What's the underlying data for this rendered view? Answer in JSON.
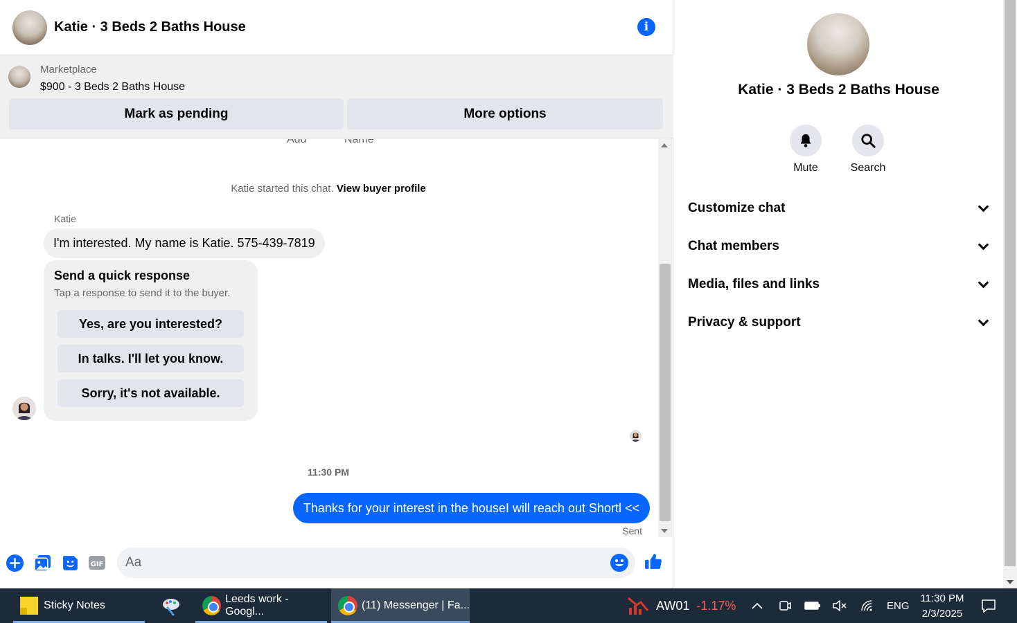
{
  "header": {
    "title": "Katie · 3 Beds 2 Baths House"
  },
  "listing": {
    "source": "Marketplace",
    "title": "$900 - 3 Beds 2 Baths House",
    "pending_label": "Mark as pending",
    "more_label": "More options"
  },
  "messages": {
    "cut_left": "Add",
    "cut_right": "Name",
    "system_text": "Katie started this chat.",
    "system_link": "View buyer profile",
    "sender": "Katie",
    "incoming": "I'm interested. My name is Katie. 575-439-7819",
    "quick": {
      "title": "Send a quick response",
      "subtitle": "Tap a response to send it to the buyer.",
      "options": [
        "Yes, are you interested?",
        "In talks. I'll let you know.",
        "Sorry, it's not available."
      ]
    },
    "timestamp": "11:30 PM",
    "outgoing": "Thanks for your interest in the houseI will reach out Shortl <<",
    "status": "Sent"
  },
  "composer": {
    "placeholder": "Aa",
    "gif_label": "GIF"
  },
  "details": {
    "name": "Katie · 3 Beds 2 Baths House",
    "actions": [
      "Mute",
      "Search"
    ],
    "sections": [
      "Customize chat",
      "Chat members",
      "Media, files and links",
      "Privacy & support"
    ]
  },
  "taskbar": {
    "items": [
      "Sticky Notes",
      "Leeds work - Googl...",
      "(11) Messenger | Fa..."
    ],
    "stock_symbol": "AW01",
    "stock_change": "-1.17%",
    "language": "ENG",
    "time": "11:30 PM",
    "date": "2/3/2025"
  },
  "colors": {
    "accent": "#0866ff",
    "bubble_in": "#f0f0f0",
    "button_bg": "#e2e5e9",
    "taskbar": "#1c2a3a",
    "stock_negative": "#ff5a5a"
  }
}
